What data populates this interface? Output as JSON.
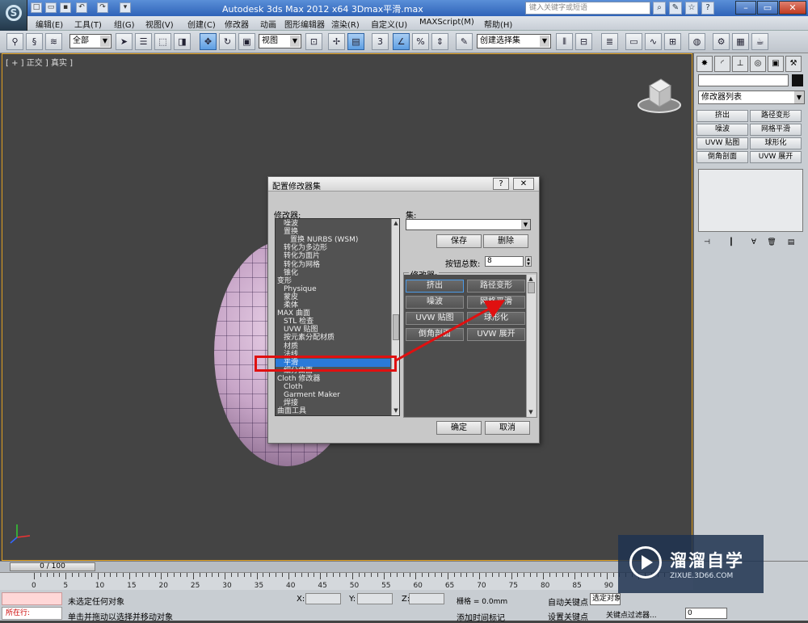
{
  "window": {
    "title": "Autodesk 3ds Max  2012 x64    3Dmax平滑.max",
    "search_placeholder": "键入关键字或短语",
    "controls": [
      "–",
      "▭",
      "✕"
    ]
  },
  "menu": [
    "编辑(E)",
    "工具(T)",
    "组(G)",
    "视图(V)",
    "创建(C)",
    "修改器",
    "动画",
    "图形编辑器",
    "渲染(R)",
    "自定义(U)",
    "MAXScript(M)",
    "帮助(H)"
  ],
  "toolbar": {
    "selection_filter": "全部",
    "reference_coord": "视图",
    "snap_value": "3",
    "named_selection": "创建选择集"
  },
  "viewport": {
    "label": "[ + ] 正交 ] 真实 ]"
  },
  "command_panel": {
    "modifier_list": "修改器列表",
    "buttons": [
      "挤出",
      "路径变形",
      "噪波",
      "网格平滑",
      "UVW 贴图",
      "球形化",
      "倒角剖面",
      "UVW 展开"
    ]
  },
  "dialog": {
    "title": "配置修改器集",
    "help": "?",
    "close": "✕",
    "modifiers_label": "修改器:",
    "modifier_items": [
      {
        "text": "噪波",
        "kind": "sub",
        "selected": false
      },
      {
        "text": "置换",
        "kind": "sub",
        "selected": false
      },
      {
        "text": "置换 NURBS (WSM)",
        "kind": "sub2",
        "selected": false
      },
      {
        "text": "转化为多边形",
        "kind": "sub",
        "selected": false
      },
      {
        "text": "转化为面片",
        "kind": "sub",
        "selected": false
      },
      {
        "text": "转化为网格",
        "kind": "sub",
        "selected": false
      },
      {
        "text": "锥化",
        "kind": "sub",
        "selected": false
      },
      {
        "text": "变形",
        "kind": "cat",
        "selected": false
      },
      {
        "text": "Physique",
        "kind": "sub",
        "selected": false
      },
      {
        "text": "蒙皮",
        "kind": "sub",
        "selected": false
      },
      {
        "text": "柔体",
        "kind": "sub",
        "selected": false
      },
      {
        "text": "MAX 曲面",
        "kind": "cat",
        "selected": false
      },
      {
        "text": "STL 检查",
        "kind": "sub",
        "selected": false
      },
      {
        "text": "UVW 贴图",
        "kind": "sub",
        "selected": false
      },
      {
        "text": "按元素分配材质",
        "kind": "sub",
        "selected": false
      },
      {
        "text": "材质",
        "kind": "sub",
        "selected": false
      },
      {
        "text": "法线",
        "kind": "sub",
        "selected": false
      },
      {
        "text": "平滑",
        "kind": "sub",
        "selected": true
      },
      {
        "text": "细分曲面",
        "kind": "sub",
        "selected": false
      },
      {
        "text": "Cloth 修改器",
        "kind": "cat",
        "selected": false
      },
      {
        "text": "Cloth",
        "kind": "sub",
        "selected": false
      },
      {
        "text": "Garment Maker",
        "kind": "sub",
        "selected": false
      },
      {
        "text": "焊接",
        "kind": "sub",
        "selected": false
      },
      {
        "text": "曲面工具",
        "kind": "cat",
        "selected": false
      }
    ],
    "set_label": "集:",
    "save": "保存",
    "delete": "删除",
    "count_label": "按钮总数:",
    "count_value": "8",
    "group_label": "修改器:",
    "buttons": [
      "挤出",
      "路径变形",
      "噪波",
      "网格平滑",
      "UVW 贴图",
      "球形化",
      "倒角剖面",
      "UVW 展开"
    ],
    "ok": "确定",
    "cancel": "取消"
  },
  "timeline": {
    "position": "0 / 100",
    "ticks": [
      "0",
      "5",
      "10",
      "15",
      "20",
      "25",
      "30",
      "35",
      "40",
      "45",
      "50",
      "55",
      "60",
      "65",
      "70",
      "75",
      "80",
      "85",
      "90"
    ]
  },
  "status": {
    "now_running": "所在行:",
    "selection": "未选定任何对象",
    "prompt": "单击并拖动以选择并移动对象",
    "x_label": "X:",
    "y_label": "Y:",
    "z_label": "Z:",
    "grid": "栅格 = 0.0mm",
    "add_time_tag": "添加时间标记",
    "auto_key": "自动关键点",
    "selected": "选定对象",
    "set_key": "设置关键点",
    "key_filters": "关键点过滤器...",
    "frame": "0"
  },
  "watermark": {
    "name": "溜溜自学",
    "url": "ZIXUE.3D66.COM"
  },
  "colors": {
    "viewport_bg": "#444444",
    "highlight": "#e01010",
    "selection_blue": "#2a7ad8"
  }
}
